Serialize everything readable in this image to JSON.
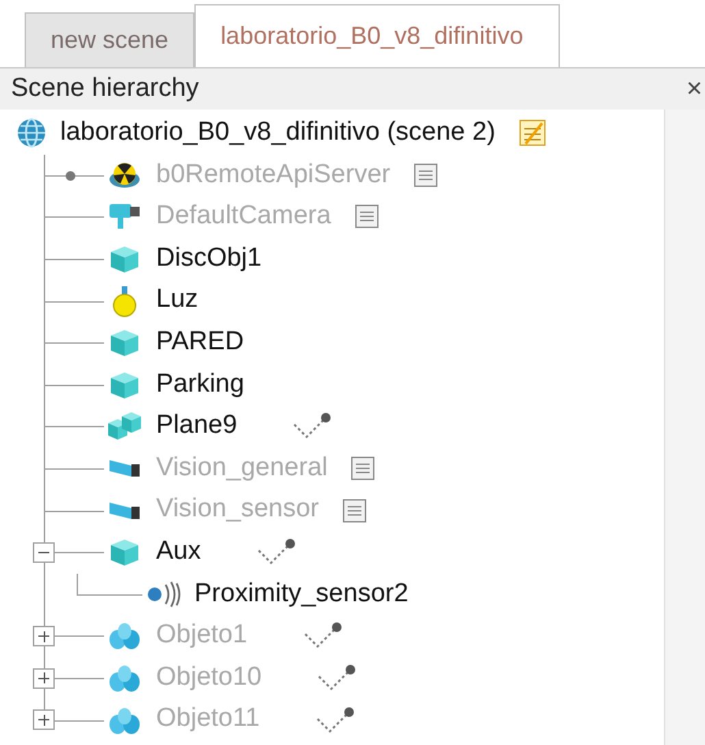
{
  "tabs": [
    {
      "label": "new scene",
      "selected": false
    },
    {
      "label": "laboratorio_B0_v8_difinitivo",
      "selected": true
    }
  ],
  "panel": {
    "title": "Scene hierarchy",
    "close": "×"
  },
  "tree": {
    "label": "laboratorio_B0_v8_difinitivo (scene 2)",
    "kind": "scene",
    "script": true,
    "children": [
      {
        "label": "b0RemoteApiServer",
        "kind": "api",
        "disabled": true,
        "script": true,
        "linked": true
      },
      {
        "label": "DefaultCamera",
        "kind": "camera",
        "disabled": true,
        "script": true
      },
      {
        "label": "DiscObj1",
        "kind": "shape",
        "disabled": false
      },
      {
        "label": "Luz",
        "kind": "light",
        "disabled": false
      },
      {
        "label": "PARED",
        "kind": "shape",
        "disabled": false
      },
      {
        "label": "Parking",
        "kind": "shape",
        "disabled": false
      },
      {
        "label": "Plane9",
        "kind": "compound",
        "disabled": false,
        "dynamic": true
      },
      {
        "label": "Vision_general",
        "kind": "vision",
        "disabled": true,
        "script": true
      },
      {
        "label": "Vision_sensor",
        "kind": "vision",
        "disabled": true,
        "script": true
      },
      {
        "label": "Aux",
        "kind": "shape",
        "disabled": false,
        "dynamic": true,
        "expanded": true,
        "children": [
          {
            "label": "Proximity_sensor2",
            "kind": "proximity",
            "disabled": false
          }
        ]
      },
      {
        "label": "Objeto1",
        "kind": "dummy",
        "disabled": true,
        "dynamic": true,
        "expanded": false
      },
      {
        "label": "Objeto10",
        "kind": "dummy",
        "disabled": true,
        "dynamic": true,
        "expanded": false
      },
      {
        "label": "Objeto11",
        "kind": "dummy",
        "disabled": true,
        "dynamic": true,
        "expanded": false
      }
    ]
  }
}
